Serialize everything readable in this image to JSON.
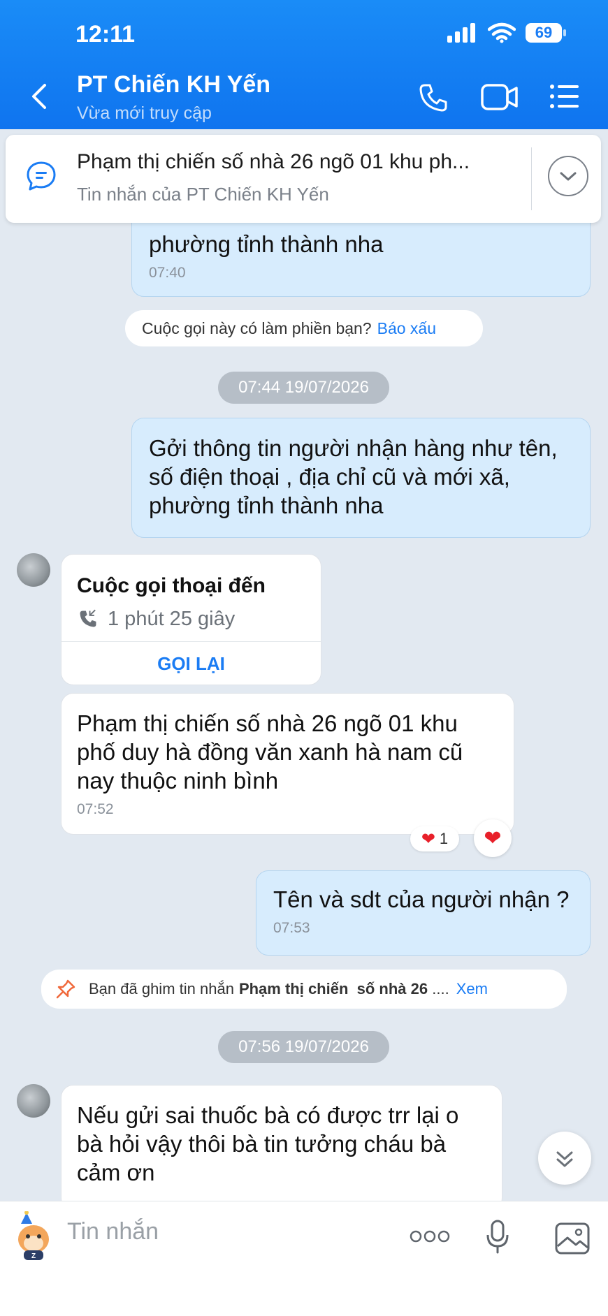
{
  "status": {
    "time": "12:11",
    "battery": "69"
  },
  "header": {
    "title": "PT Chiến KH Yến",
    "subtitle": "Vừa mới truy cập"
  },
  "pinned": {
    "text": "Phạm thị chiến  số nhà 26  ngõ  01 khu ph...",
    "sub": "Tin nhắn của PT Chiến KH Yến"
  },
  "messages": {
    "m1": {
      "text": "phường tỉnh thành nha",
      "time": "07:40"
    },
    "spam_prompt": {
      "question": "Cuộc gọi này có làm phiền bạn?",
      "action": "Báo xấu"
    },
    "date1": "07:44 19/07/2026",
    "m2": {
      "text": "Gởi thông tin người nhận hàng như tên, số điện thoại , địa chỉ cũ và mới xã, phường tỉnh thành nha"
    },
    "call": {
      "title": "Cuộc gọi thoại đến",
      "duration": "1 phút 25 giây",
      "callback": "GỌI LẠI"
    },
    "m3": {
      "text": "Phạm thị chiến  số nhà 26  ngõ  01 khu phố duy hà đồng văn xanh  hà nam cũ nay thuộc ninh bình",
      "time": "07:52",
      "reaction_count": "1"
    },
    "m4": {
      "text": "Tên và sdt của người nhận ?",
      "time": "07:53"
    },
    "pin_notice": {
      "prefix": "Bạn đã ghim tin nhắn",
      "bold": "Phạm thị chiến  số nhà 26",
      "suffix": " ....",
      "action": "Xem"
    },
    "date2": "07:56 19/07/2026",
    "m5": {
      "text": "Nếu gửi sai thuốc bà có được trr lại o bà hỏi vậy thôi bà tin tưởng cháu  bà cảm ơn"
    }
  },
  "composer": {
    "placeholder": "Tin nhắn"
  },
  "colors": {
    "accent": "#1a7cf4",
    "header": "#0f74ef",
    "outgoing": "#d7ecfd"
  }
}
